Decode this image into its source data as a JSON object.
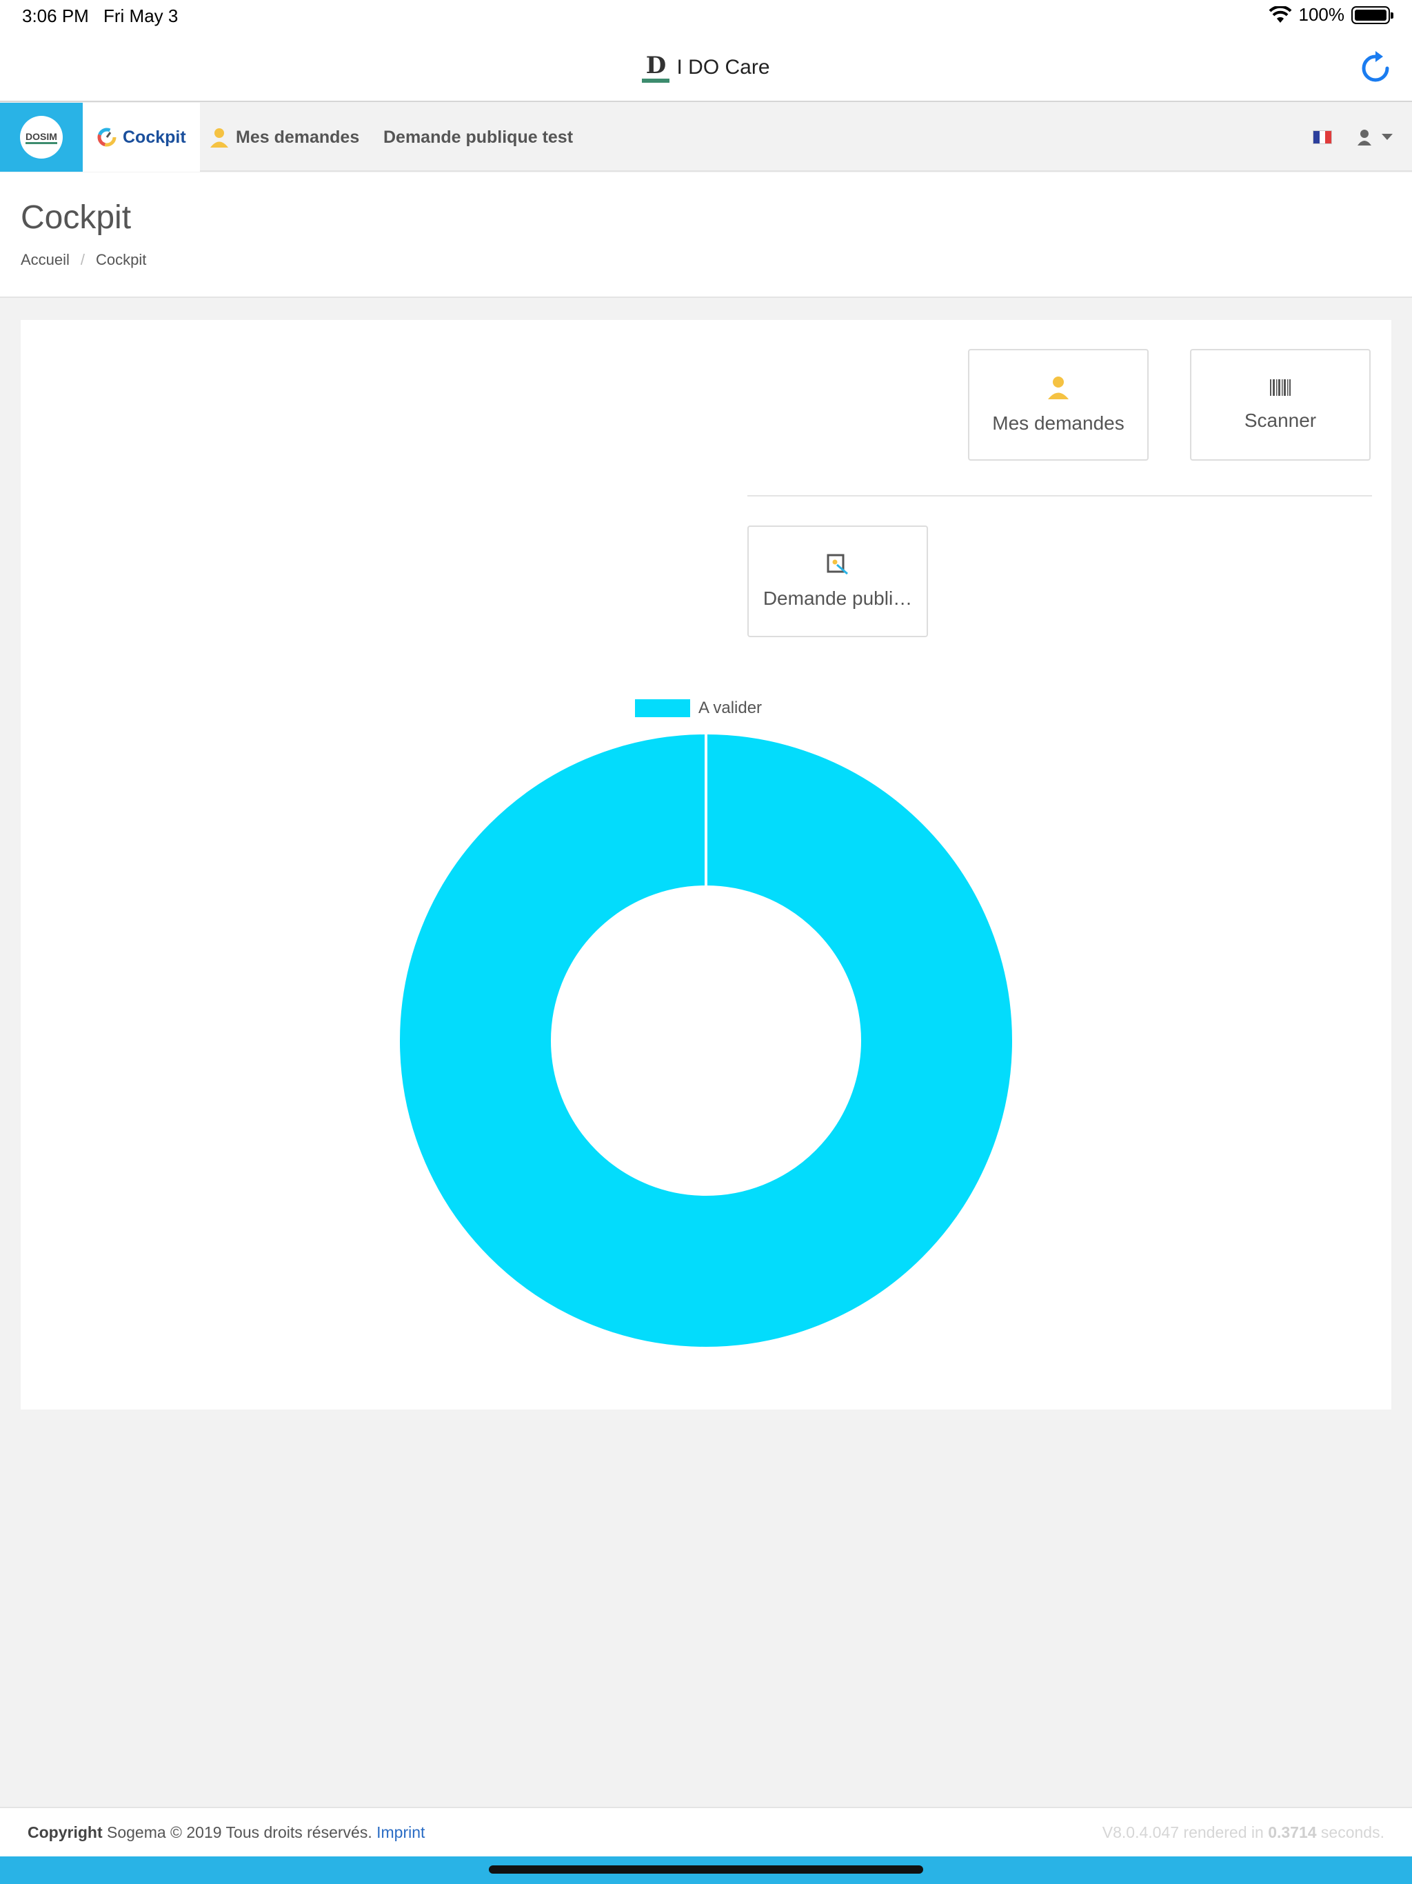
{
  "status_bar": {
    "time": "3:06 PM",
    "date": "Fri May 3",
    "battery": "100%"
  },
  "app_bar": {
    "title": "I DO Care",
    "logo_letter": "D"
  },
  "nav": {
    "brand": "DOSIM",
    "items": [
      {
        "label": "Cockpit",
        "active": true
      },
      {
        "label": "Mes demandes",
        "active": false
      },
      {
        "label": "Demande publique test",
        "active": false
      }
    ]
  },
  "page": {
    "title": "Cockpit",
    "breadcrumb": [
      "Accueil",
      "Cockpit"
    ],
    "breadcrumb_sep": "/"
  },
  "tiles": [
    {
      "label": "Mes demandes",
      "icon": "user-icon"
    },
    {
      "label": "Scanner",
      "icon": "barcode-icon"
    },
    {
      "label": "Demande publi…",
      "icon": "public-request-icon"
    }
  ],
  "chart_data": {
    "type": "pie",
    "donut": true,
    "categories": [
      "A valider"
    ],
    "values": [
      1
    ],
    "colors": [
      "#03dcfc"
    ],
    "legend": "top"
  },
  "footer": {
    "copyright_label": "Copyright",
    "copyright_text": " Sogema © 2019 Tous droits réservés. ",
    "imprint": "Imprint",
    "version_prefix": "V8.0.4.047 rendered in ",
    "render_time": "0.3714",
    "version_suffix": " seconds."
  },
  "colors": {
    "accent": "#29b3e6",
    "brand_green": "#3d8c6e",
    "link": "#2a6cc4",
    "user_icon": "#f5c242"
  }
}
